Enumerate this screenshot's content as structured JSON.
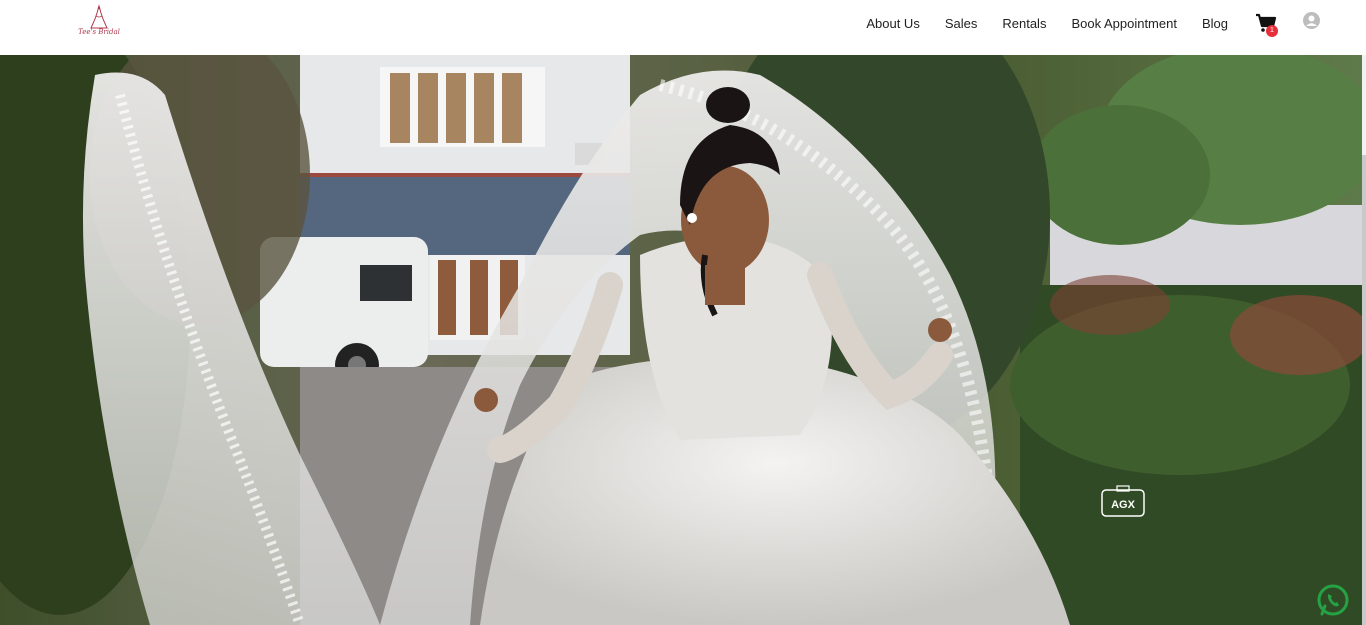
{
  "brand": {
    "logo_text": "Tee's Bridal",
    "logo_color": "#b0384e"
  },
  "nav": {
    "items": [
      {
        "label": "About Us"
      },
      {
        "label": "Sales"
      },
      {
        "label": "Rentals"
      },
      {
        "label": "Book Appointment"
      },
      {
        "label": "Blog"
      }
    ]
  },
  "cart": {
    "count": "1",
    "icon": "cart-icon",
    "badge_color": "#e5303c"
  },
  "account": {
    "icon": "user-icon"
  },
  "hero": {
    "description_icon": "photo",
    "watermark_text": "AGX"
  },
  "whatsapp": {
    "icon": "whatsapp-icon",
    "color": "#25a244"
  }
}
